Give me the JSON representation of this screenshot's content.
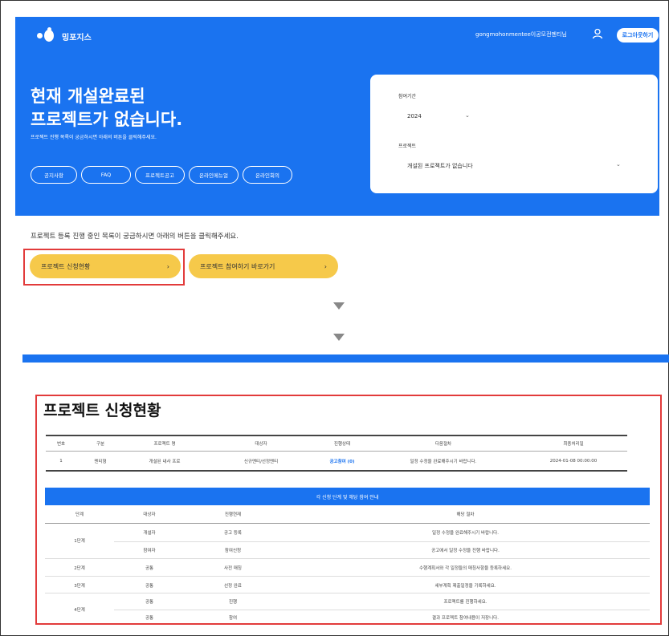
{
  "header": {
    "logo_text": "밍포지스",
    "user_text": "gongmohonmentee이공모전멘티님",
    "logout_label": "로그아웃하기",
    "user_icon": "user-icon"
  },
  "hero": {
    "title_line1": "현재 개설완료된",
    "title_line2": "프로젝트가 없습니다.",
    "subtitle": "프로젝트 진행 목록이 궁금하시면 아래의 버튼을 클릭해주세요.",
    "pills": [
      "공지사항",
      "FAQ",
      "프로젝트공고",
      "온라인메뉴얼",
      "온라인회의"
    ]
  },
  "filter_card": {
    "year_label": "참여기간",
    "year_value": "2024",
    "project_label": "프로젝트",
    "project_value": "개설된 프로젝트가 없습니다"
  },
  "main": {
    "description": "프로젝트 등록 진행 중인 목록이 궁금하시면 아래의 버튼을 클릭해주세요.",
    "btn_status_label": "프로젝트 신청현황",
    "btn_join_label": "프로젝트 참여하기 바로가기",
    "arrow": "›"
  },
  "status": {
    "title": "프로젝트 신청현황",
    "columns": [
      "번호",
      "구분",
      "프로젝트 명",
      "대상자",
      "진행상태",
      "다음절차",
      "최종처리일"
    ],
    "row": [
      "1",
      "멘티형",
      "개설된 내사 프로",
      "신규멘티/선정멘티",
      "공고참여 (0)",
      "일정 수정을 완료해주시기 바랍니다.",
      "2024-01-08 00:00:00"
    ]
  },
  "guide": {
    "title": "각 신청 단계 및 해당 참여 안내",
    "columns": [
      "단계",
      "대상자",
      "진행현재",
      "해당 절차"
    ],
    "rows": [
      {
        "stage": "1단계",
        "target": "개설자",
        "state": "공고 등록",
        "proc": "일정 수정을 완료해주시기 바랍니다."
      },
      {
        "stage": "",
        "target": "참여자",
        "state": "참여신청",
        "proc": "공고에서 일정 수정을 진행 바랍니다."
      },
      {
        "stage": "2단계",
        "target": "공통",
        "state": "사전 매칭",
        "proc": "수행계획서와 각 일정들의 매칭사항을 등록하세요."
      },
      {
        "stage": "3단계",
        "target": "공통",
        "state": "선정 완료",
        "proc": "세부계획 제출일정을 기록하세요."
      },
      {
        "stage": "",
        "target": "공통",
        "state": "진행",
        "proc": "프로젝트를 진행하세요."
      },
      {
        "stage": "4단계",
        "target": "공통",
        "state": "참여",
        "proc": "결과 프로젝트 참여내용이 저장니다."
      }
    ]
  }
}
